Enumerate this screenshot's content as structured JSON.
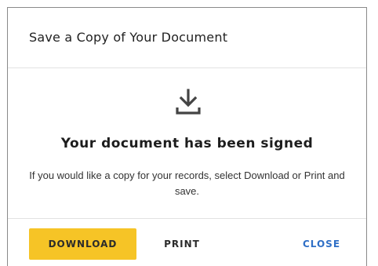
{
  "dialog": {
    "title": "Save a Copy of Your Document",
    "icon": "download-icon",
    "heading": "Your document has been signed",
    "description": "If you would like a copy for your records, select Download or Print and save.",
    "buttons": {
      "download": "DOWNLOAD",
      "print": "PRINT",
      "close": "CLOSE"
    },
    "colors": {
      "primary_button": "#f6c426",
      "close_link": "#2f6fc6",
      "icon": "#444444"
    }
  }
}
